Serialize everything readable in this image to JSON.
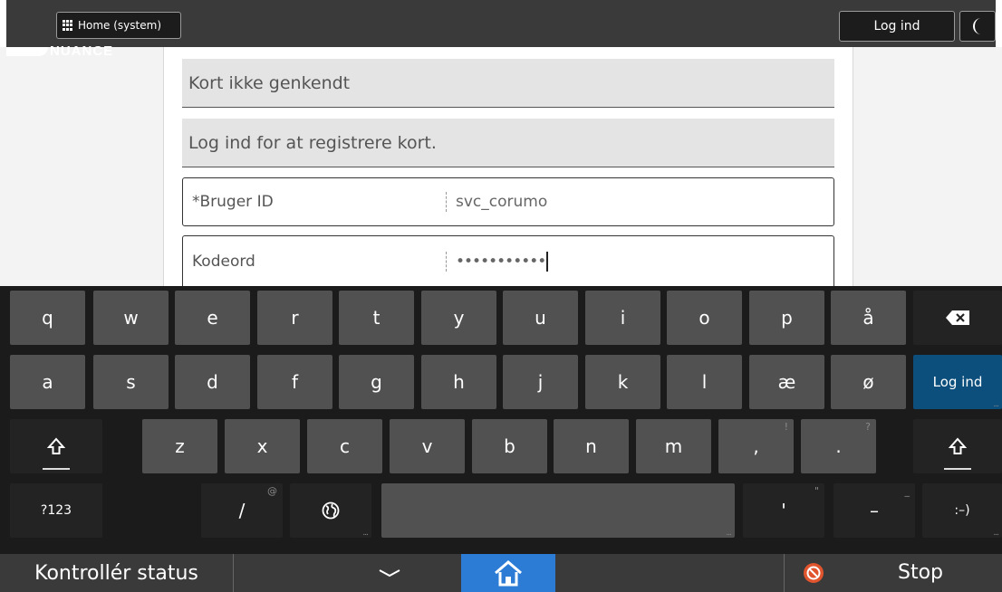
{
  "topbar": {
    "home_label": "Home (system)",
    "login_label": "Log ind"
  },
  "logo": {
    "text": "NUANCE"
  },
  "messages": {
    "card_not_recognized": "Kort ikke genkendt",
    "login_to_register": "Log ind for at registrere kort."
  },
  "form": {
    "user_label": "*Bruger ID",
    "user_value": "svc_corumo",
    "password_label": "Kodeord",
    "password_masked": "•••••••••••"
  },
  "keyboard": {
    "row1": [
      "q",
      "w",
      "e",
      "r",
      "t",
      "y",
      "u",
      "i",
      "o",
      "p",
      "å"
    ],
    "row2": [
      "a",
      "s",
      "d",
      "f",
      "g",
      "h",
      "j",
      "k",
      "l",
      "æ",
      "ø"
    ],
    "row3": [
      "z",
      "x",
      "c",
      "v",
      "b",
      "n",
      "m",
      ",",
      "."
    ],
    "row3_hints": [
      "",
      "",
      "",
      "",
      "",
      "",
      "",
      "!",
      "?"
    ],
    "login_key": "Log ind",
    "numbers_key": "?123",
    "slash_key": "/",
    "slash_hint": "@",
    "apostrophe_key": "'",
    "apostrophe_hint": "\"",
    "dash_key": "–",
    "dash_hint": "_",
    "smiley_key": ":–)"
  },
  "bottombar": {
    "status_label": "Kontrollér status",
    "stop_label": "Stop"
  },
  "colors": {
    "accent_blue": "#2c7cd6",
    "login_key_blue": "#0c4f7c",
    "stop_red": "#e0552e"
  },
  "icons": {
    "home_grid": "apps-grid-icon",
    "moon": "moon-icon",
    "backspace": "backspace-icon",
    "shift": "shift-icon",
    "globe": "globe-icon",
    "chevron": "chevron-down-icon",
    "home": "home-icon",
    "stop": "stop-icon"
  }
}
